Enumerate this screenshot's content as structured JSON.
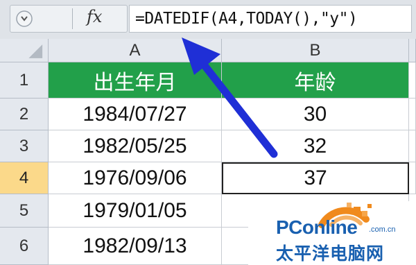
{
  "formula_bar": {
    "fx_label": "fx",
    "formula": "=DATEDIF(A4,TODAY(),\"y\")"
  },
  "columns": [
    {
      "label": "A"
    },
    {
      "label": "B"
    }
  ],
  "rows": [
    {
      "num": "1",
      "a": "出生年月",
      "b": "年龄"
    },
    {
      "num": "2",
      "a": "1984/07/27",
      "b": "30"
    },
    {
      "num": "3",
      "a": "1982/05/25",
      "b": "32"
    },
    {
      "num": "4",
      "a": "1976/09/06",
      "b": "37"
    },
    {
      "num": "5",
      "a": "1979/01/05",
      "b": ""
    },
    {
      "num": "6",
      "a": "1982/09/13",
      "b": ""
    }
  ],
  "watermark": {
    "brand": "PConline",
    "domain": ".com.cn",
    "chinese": "太平洋电脑网"
  },
  "colors": {
    "header_green": "#22a04a",
    "active_row_header": "#fbd98a",
    "arrow_blue": "#1f2fd6",
    "logo_orange": "#f08a1d",
    "logo_blue": "#1960b0"
  },
  "active_cell": "B4"
}
